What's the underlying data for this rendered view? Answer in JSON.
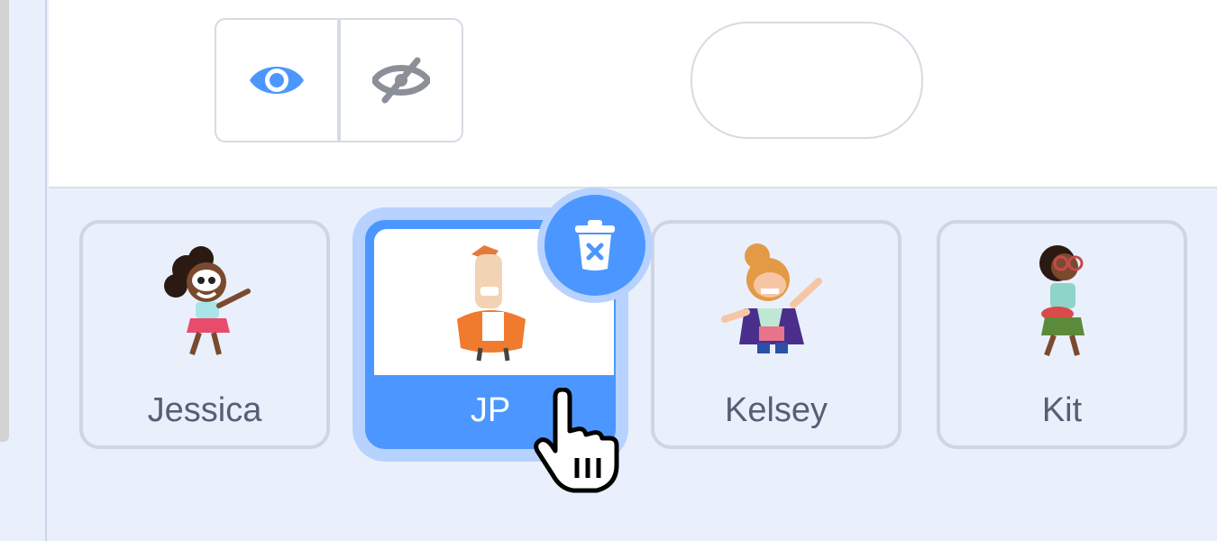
{
  "toggle": {
    "show_icon": "eye-icon",
    "hide_icon": "eye-slash-icon",
    "active_color": "#4c97ff",
    "inactive_color": "#8a8f98"
  },
  "size_field": {
    "value": ""
  },
  "sprites": [
    {
      "name": "Jessica",
      "selected": false
    },
    {
      "name": "JP",
      "selected": true
    },
    {
      "name": "Kelsey",
      "selected": false
    },
    {
      "name": "Kit",
      "selected": false
    }
  ],
  "colors": {
    "accent": "#4c97ff",
    "accent_glow": "#b7d2ff",
    "tray_bg": "#e9f0fc"
  },
  "icons": {
    "delete": "trash-icon",
    "cursor": "hand-pointer-icon"
  }
}
